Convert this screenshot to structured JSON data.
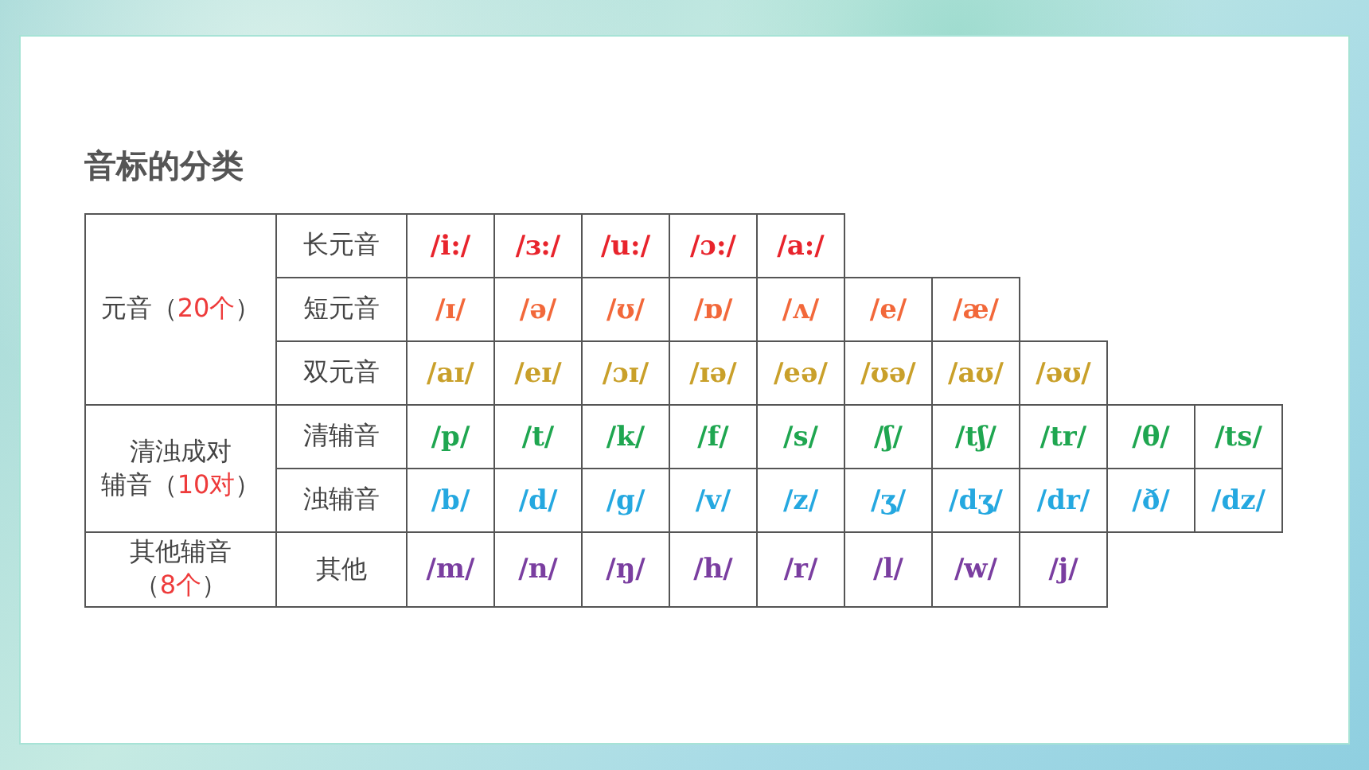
{
  "title": "音标的分类",
  "groups": [
    {
      "lines": [
        {
          "text": "元音",
          "open": "（",
          "count": "20个",
          "close": "）"
        }
      ],
      "rows": [
        {
          "label": "长元音",
          "color": "#e8242c",
          "symbols": [
            "/i:/",
            "/ɜ:/",
            "/u:/",
            "/ɔ:/",
            "/a:/"
          ]
        },
        {
          "label": "短元音",
          "color": "#f2683a",
          "symbols": [
            "/ɪ/",
            "/ə/",
            "/ʊ/",
            "/ɒ/",
            "/ʌ/",
            "/e/",
            "/æ/"
          ]
        },
        {
          "label": "双元音",
          "color": "#c9a02a",
          "symbols": [
            "/aɪ/",
            "/eɪ/",
            "/ɔɪ/",
            "/ɪə/",
            "/eə/",
            "/ʊə/",
            "/aʊ/",
            "/əʊ/"
          ]
        }
      ]
    },
    {
      "lines": [
        {
          "text": "清浊成对"
        },
        {
          "text": "辅音",
          "open": "（",
          "count": "10对",
          "close": "）"
        }
      ],
      "rows": [
        {
          "label": "清辅音",
          "color": "#1fa650",
          "symbols": [
            "/p/",
            "/t/",
            "/k/",
            "/f/",
            "/s/",
            "/ʃ/",
            "/tʃ/",
            "/tr/",
            "/θ/",
            "/ts/"
          ]
        },
        {
          "label": "浊辅音",
          "color": "#25a8e0",
          "symbols": [
            "/b/",
            "/d/",
            "/g/",
            "/v/",
            "/z/",
            "/ʒ/",
            "/dʒ/",
            "/dr/",
            "/ð/",
            "/dz/"
          ]
        }
      ]
    },
    {
      "lines": [
        {
          "text": "其他辅音"
        },
        {
          "open": "（",
          "count": "8个",
          "close": "）"
        }
      ],
      "rows": [
        {
          "label": "其他",
          "color": "#7a3ea0",
          "symbols": [
            "/m/",
            "/n/",
            "/ŋ/",
            "/h/",
            "/r/",
            "/l/",
            "/w/",
            "/j/"
          ]
        }
      ]
    }
  ]
}
